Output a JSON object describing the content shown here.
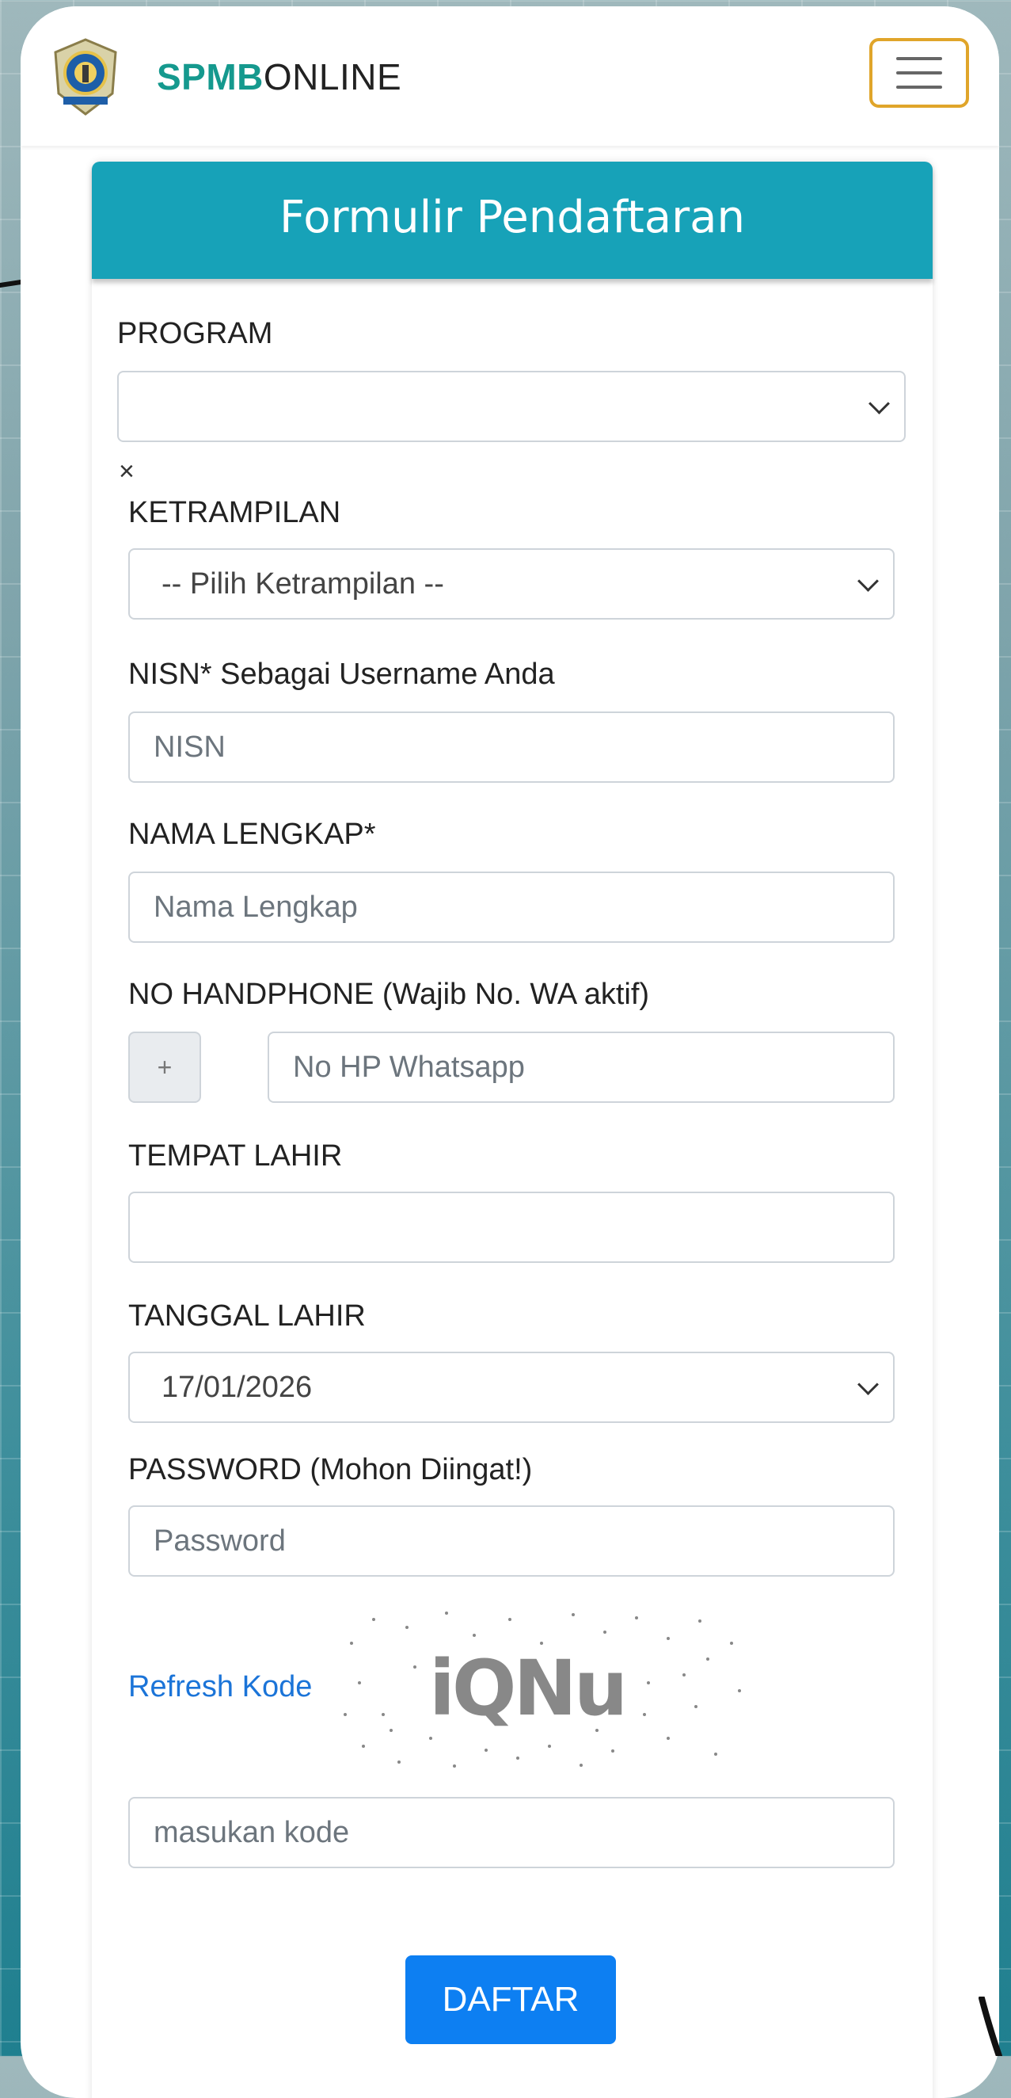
{
  "navbar": {
    "brand_prefix": "SPMB",
    "brand_suffix": "ONLINE",
    "logo_icon": "school-emblem-icon",
    "menu_icon": "hamburger-menu-icon"
  },
  "form": {
    "title": "Formulir Pendaftaran",
    "program": {
      "label": "PROGRAM",
      "value": ""
    },
    "clear_symbol": "×",
    "ketrampilan": {
      "label": "KETRAMPILAN",
      "value": "-- Pilih Ketrampilan --"
    },
    "nisn": {
      "label": "NISN* Sebagai Username Anda",
      "placeholder": "NISN"
    },
    "nama": {
      "label": "NAMA LENGKAP*",
      "placeholder": "Nama Lengkap"
    },
    "handphone": {
      "label": "NO HANDPHONE (Wajib No. WA aktif)",
      "prefix": "+",
      "placeholder": "No HP Whatsapp"
    },
    "tempat_lahir": {
      "label": "TEMPAT LAHIR",
      "value": ""
    },
    "tanggal_lahir": {
      "label": "TANGGAL LAHIR",
      "value": "17/01/2026"
    },
    "password": {
      "label": "PASSWORD (Mohon Diingat!)",
      "placeholder": "Password"
    },
    "captcha": {
      "refresh_label": "Refresh Kode",
      "code": "iQNu",
      "placeholder": "masukan kode"
    },
    "submit_label": "DAFTAR"
  },
  "colors": {
    "header_bg": "#17a2b8",
    "brand_green": "#15998e",
    "button_blue": "#0d7ff2",
    "link_blue": "#1b74d8",
    "menu_border": "#e0a52a"
  }
}
